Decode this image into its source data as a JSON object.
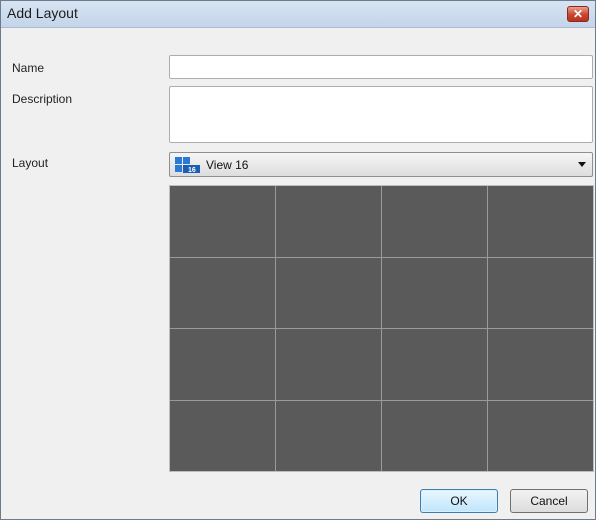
{
  "window": {
    "title": "Add Layout",
    "close_glyph": "✕"
  },
  "form": {
    "name_label": "Name",
    "name_value": "",
    "description_label": "Description",
    "description_value": "",
    "layout_label": "Layout",
    "layout_selected": "View 16",
    "layout_icon": "view-16-icon",
    "layout_icon_badge": "16"
  },
  "preview": {
    "rows": 4,
    "columns": 4
  },
  "buttons": {
    "ok": "OK",
    "cancel": "Cancel"
  },
  "colors": {
    "cell": "#5a5a5a",
    "grid_line": "#9a9a9a",
    "title_bar": "#c4d5ea"
  }
}
